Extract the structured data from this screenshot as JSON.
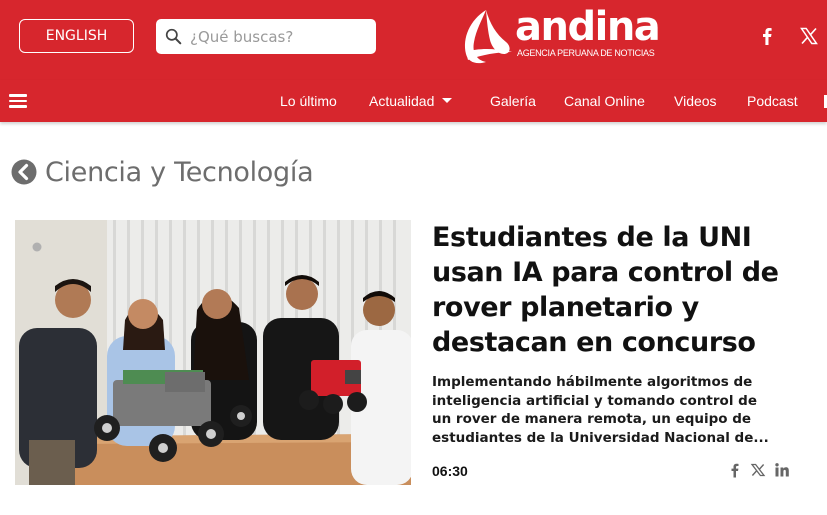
{
  "header": {
    "language_button": "ENGLISH",
    "search": {
      "placeholder": "¿Qué buscas?",
      "value": ""
    },
    "logo": {
      "name": "andina",
      "tagline": "AGENCIA PERUANA DE NOTICIAS"
    },
    "social": [
      "facebook-icon",
      "x-icon"
    ],
    "brand_color": "#d7262d"
  },
  "nav": {
    "items": [
      {
        "label": "Lo último"
      },
      {
        "label": "Actualidad",
        "has_dropdown": true
      },
      {
        "label": "Galería"
      },
      {
        "label": "Canal Online"
      },
      {
        "label": "Videos"
      },
      {
        "label": "Podcast"
      }
    ]
  },
  "section": {
    "title": "Ciencia y Tecnología",
    "back_icon": "chevron-left-circle-icon"
  },
  "article": {
    "headline": "Estudiantes de la UNI usan IA para control de rover planetario y destacan en concurso",
    "summary": "Implementando hábilmente algoritmos de inteligencia artificial y tomando control de un rover de manera remota, un equipo de estudiantes de la Universidad Nacional de...",
    "time": "06:30",
    "share": [
      "facebook-icon",
      "x-icon",
      "linkedin-icon"
    ]
  }
}
